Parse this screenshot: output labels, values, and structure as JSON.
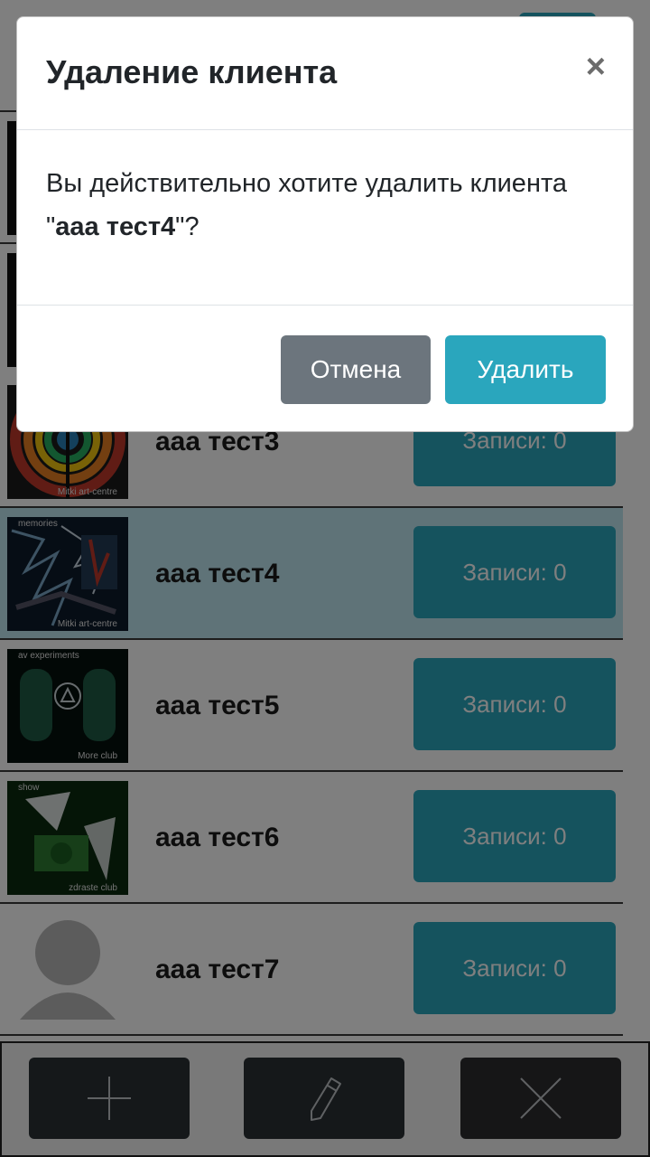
{
  "clients": [
    {
      "name": "aaa тест3",
      "records_label": "Записи: 0",
      "thumb": "art-thumbnail",
      "caption_top": "",
      "caption_bottom": "Mitki art-centre",
      "selected": false
    },
    {
      "name": "aaa тест4",
      "records_label": "Записи: 0",
      "thumb": "art-thumbnail",
      "caption_top": "memories",
      "caption_bottom": "Mitki art-centre",
      "selected": true
    },
    {
      "name": "aaa тест5",
      "records_label": "Записи: 0",
      "thumb": "art-thumbnail",
      "caption_top": "av experiments",
      "caption_bottom": "More club",
      "selected": false
    },
    {
      "name": "aaa тест6",
      "records_label": "Записи: 0",
      "thumb": "art-thumbnail",
      "caption_top": "show",
      "caption_bottom": "zdraste club",
      "selected": false
    },
    {
      "name": "aaa тест7",
      "records_label": "Записи: 0",
      "thumb": "default-avatar-icon",
      "caption_top": "",
      "caption_bottom": "",
      "selected": false
    }
  ],
  "toolbar": {
    "add_icon": "plus-icon",
    "edit_icon": "pencil-icon",
    "delete_icon": "close-icon"
  },
  "modal": {
    "title": "Удаление клиента",
    "close_glyph": "×",
    "message_prefix": "Вы действительно хотите удалить клиента \"",
    "client_name": "aaa тест4",
    "message_suffix": "\"?",
    "cancel_label": "Отмена",
    "delete_label": "Удалить"
  },
  "colors": {
    "accent": "#2aa6bd",
    "secondary": "#6c757d",
    "selected_row": "#bfe6f0",
    "toolbar_button": "#2b3035"
  }
}
